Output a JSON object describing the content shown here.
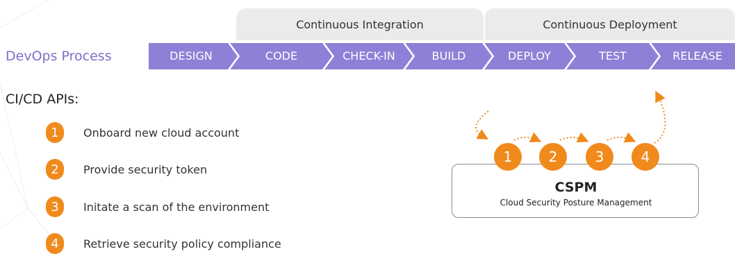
{
  "phases": {
    "ci": "Continuous Integration",
    "cd": "Continuous Deployment"
  },
  "process": {
    "title": "DevOps Process",
    "steps": [
      "DESIGN",
      "CODE",
      "CHECK-IN",
      "BUILD",
      "DEPLOY",
      "TEST",
      "RELEASE"
    ]
  },
  "apis": {
    "title": "CI/CD APIs:",
    "items": [
      {
        "num": "1",
        "text": "Onboard new cloud account"
      },
      {
        "num": "2",
        "text": "Provide security token"
      },
      {
        "num": "3",
        "text": "Initate a scan of the environment"
      },
      {
        "num": "4",
        "text": "Retrieve security policy compliance"
      }
    ]
  },
  "cspm": {
    "title": "CSPM",
    "subtitle": "Cloud Security Posture Management",
    "steps": [
      "1",
      "2",
      "3",
      "4"
    ]
  },
  "colors": {
    "accent": "#f08a1c",
    "chevron": "#8e80d6",
    "process_title": "#7b6fc7",
    "phase_bg": "#ebebeb"
  }
}
